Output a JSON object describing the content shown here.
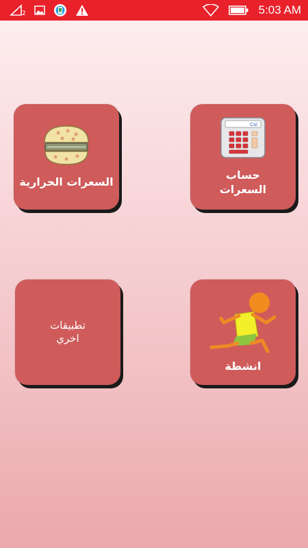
{
  "status_bar": {
    "sim_number": "2",
    "time": "5:03 AM",
    "background": "#e8212b"
  },
  "tiles": [
    {
      "id": "calories",
      "label": "السعرات الحرارية",
      "icon": "burger-icon"
    },
    {
      "id": "calc",
      "label_line1": "حساب",
      "label_line2": "السعرات",
      "icon": "calculator-icon",
      "calc_screen_text": "Cal"
    },
    {
      "id": "other",
      "label_line1": "تطبيقات",
      "label_line2": "اخري"
    },
    {
      "id": "activities",
      "label": "انشطة",
      "icon": "running-man-icon"
    }
  ],
  "colors": {
    "tile": "#cf5b5b",
    "tile_shadow": "#1a1a1a",
    "text": "#ffffff"
  }
}
